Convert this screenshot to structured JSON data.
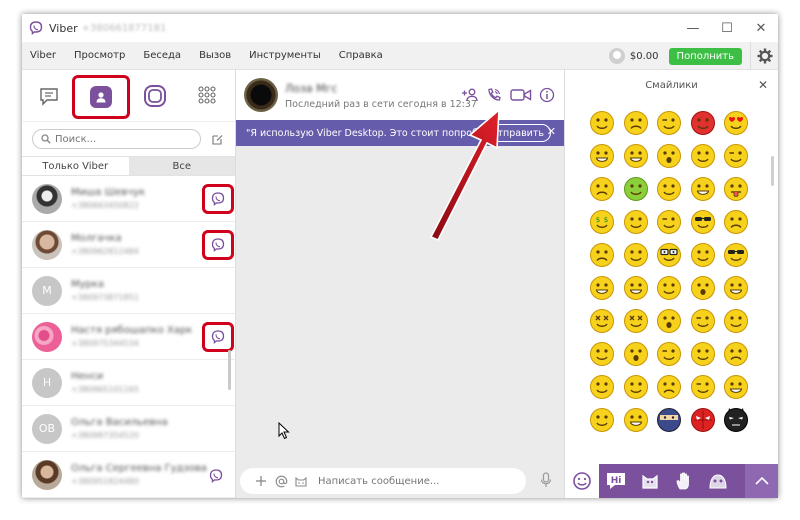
{
  "window": {
    "title": "Viber",
    "title_phone": "+380661877181",
    "controls": [
      "—",
      "☐",
      "✕"
    ]
  },
  "menu": {
    "items": [
      "Viber",
      "Просмотр",
      "Беседа",
      "Вызов",
      "Инструменты",
      "Справка"
    ],
    "balance": "$0.00",
    "topup_label": "Пополнить"
  },
  "sidebar": {
    "search_placeholder": "Поиск...",
    "tabs": [
      "Только Viber",
      "Все"
    ],
    "contacts": [
      {
        "name": "Миша Шевчук",
        "phone": "+380663450822",
        "initial": "",
        "photo": "photo1",
        "viber": true,
        "highlight": true
      },
      {
        "name": "Молгачка",
        "phone": "+380962812484",
        "initial": "",
        "photo": "photo2",
        "viber": true,
        "highlight": true
      },
      {
        "name": "Мурка",
        "phone": "+380973871851",
        "initial": "М",
        "photo": "gray",
        "viber": false,
        "highlight": false
      },
      {
        "name": "Настя рябошапко Харк",
        "phone": "+380975344534",
        "initial": "",
        "photo": "photo3",
        "viber": true,
        "highlight": true
      },
      {
        "name": "Ненси",
        "phone": "+380965101165",
        "initial": "Н",
        "photo": "gray",
        "viber": false,
        "highlight": false
      },
      {
        "name": "Ольга Васильевна",
        "phone": "+380987354520",
        "initial": "ОВ",
        "photo": "gray",
        "viber": false,
        "highlight": false
      },
      {
        "name": "Ольга Сергеевна Гудзова",
        "phone": "+380951824480",
        "initial": "",
        "photo": "photo4",
        "viber": true,
        "highlight": false
      }
    ]
  },
  "chat": {
    "contact_name": "Лоза Мгс",
    "status": "Последний раз в сети сегодня в 12:37",
    "banner_text": "\"Я использую Viber Desktop. Это стоит попробовать!\"",
    "banner_send": "Отправить",
    "banner_close": "✕",
    "composer_placeholder": "Написать сообщение..."
  },
  "smileys": {
    "title": "Смайлики",
    "close": "✕"
  },
  "colors": {
    "viber_purple": "#7b519d",
    "banner_purple": "#665cac",
    "highlight_red": "#d0021b",
    "topup_green": "#3dbf46"
  }
}
